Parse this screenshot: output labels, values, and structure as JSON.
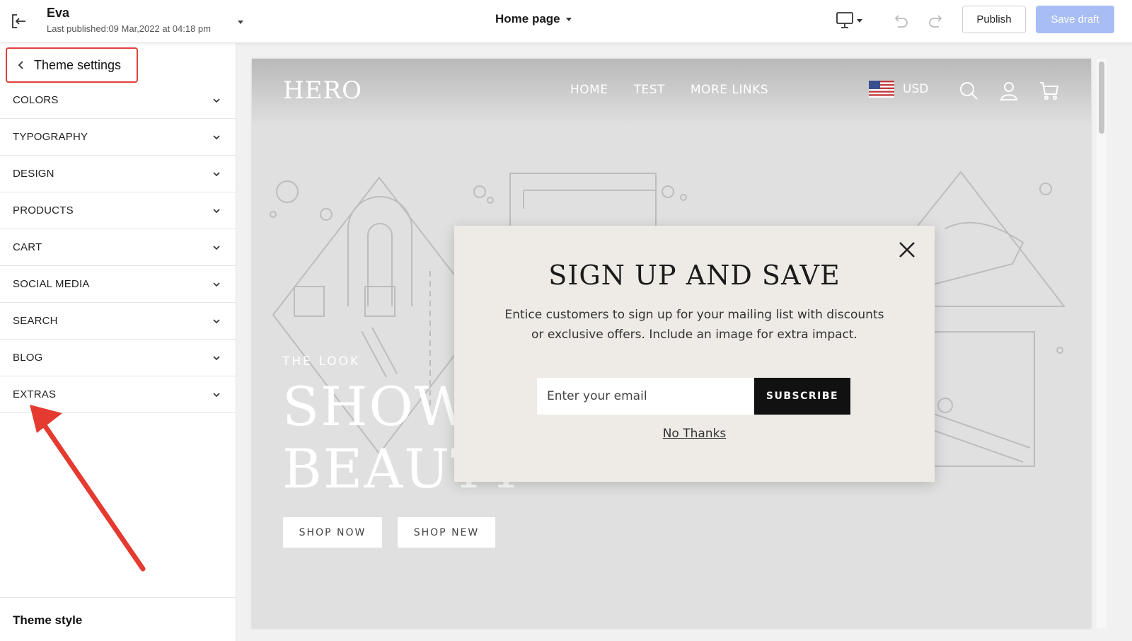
{
  "topbar": {
    "store_name": "Eva",
    "last_published": "Last published:09 Mar,2022 at 04:18 pm",
    "page_selector": "Home page",
    "publish_label": "Publish",
    "save_draft_label": "Save draft",
    "icons": {
      "exit": "exit-icon",
      "device": "desktop-icon",
      "undo": "undo-icon",
      "redo": "redo-icon"
    },
    "colors": {
      "save_draft_bg": "#a9bdf5"
    }
  },
  "sidebar": {
    "header": "Theme settings",
    "items": [
      {
        "label": "COLORS"
      },
      {
        "label": "TYPOGRAPHY"
      },
      {
        "label": "DESIGN"
      },
      {
        "label": "PRODUCTS"
      },
      {
        "label": "CART"
      },
      {
        "label": "SOCIAL MEDIA"
      },
      {
        "label": "SEARCH"
      },
      {
        "label": "BLOG"
      },
      {
        "label": "EXTRAS"
      }
    ],
    "footer": "Theme style",
    "colors": {
      "highlight": "#e0403a"
    }
  },
  "preview": {
    "logo": "HERO",
    "nav": [
      "HOME",
      "TEST",
      "MORE LINKS"
    ],
    "currency": "USD",
    "hero": {
      "eyebrow": "THE LOOK",
      "title": "SHOW\nBEAUTY",
      "buttons": [
        "SHOP NOW",
        "SHOP NEW"
      ]
    },
    "popup": {
      "title": "SIGN UP AND SAVE",
      "text": "Entice customers to sign up for your mailing list with discounts or exclusive offers. Include an image for extra impact.",
      "email_placeholder": "Enter your email",
      "subscribe_label": "SUBSCRIBE",
      "dismiss_label": "No Thanks"
    }
  }
}
